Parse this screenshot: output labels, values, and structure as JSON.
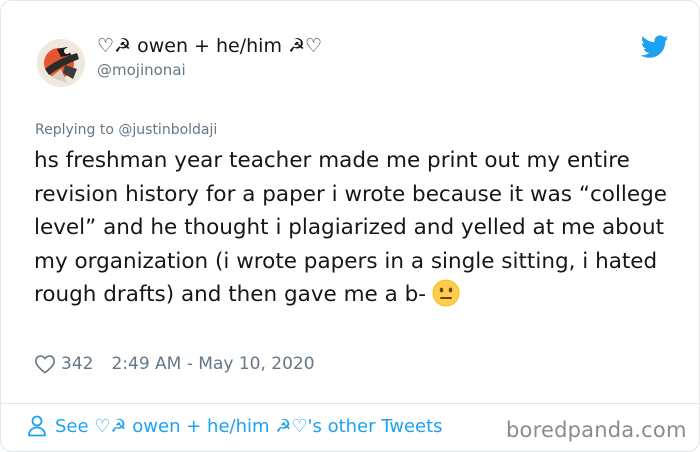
{
  "tweet": {
    "display_name": "♡☭ owen + he/him ☭♡",
    "handle": "@mojinonai",
    "reply_prefix": "Replying to ",
    "reply_to": "@justinboldaji",
    "text": "hs freshman year teacher made me print out my entire revision history for a paper i wrote because it was “college level” and he thought i plagiarized and yelled at me about my organization (i wrote papers in a single sitting, i hated rough drafts) and then gave me a b-",
    "emoji": "neutral-face-emoji",
    "likes": "342",
    "timestamp": "2:49 AM - May 10, 2020"
  },
  "footer": {
    "other_tweets_label": "See ♡☭ owen + he/him ☭♡'s other Tweets"
  },
  "watermark": "boredpanda.com",
  "colors": {
    "twitter_blue": "#1da1f2",
    "text_primary": "#14171a",
    "text_secondary": "#657786",
    "border": "#e1e8ed"
  },
  "icons": [
    "avatar",
    "twitter-bird-icon",
    "heart-icon",
    "person-icon",
    "neutral-face-emoji"
  ]
}
